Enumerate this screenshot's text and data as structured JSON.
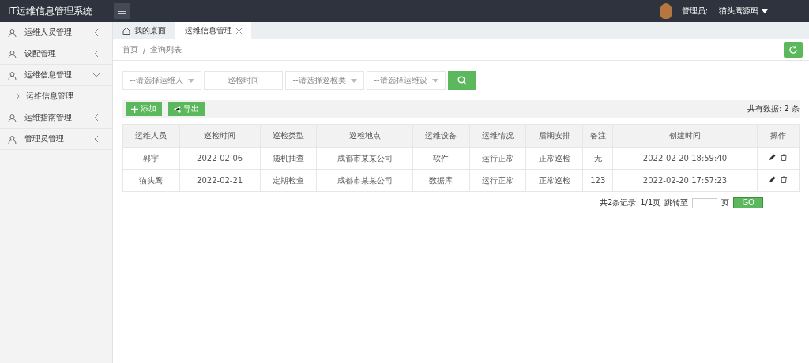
{
  "header": {
    "title": "IT运维信息管理系统",
    "user_label": "管理员:",
    "user_name": "猫头鹰源码"
  },
  "sidebar": {
    "items": [
      {
        "label": "运维人员管理",
        "expanded": false
      },
      {
        "label": "设配管理",
        "expanded": false
      },
      {
        "label": "运维信息管理",
        "expanded": true,
        "children": [
          {
            "label": "运维信息管理"
          }
        ]
      },
      {
        "label": "运维指南管理",
        "expanded": false
      },
      {
        "label": "管理员管理",
        "expanded": false
      }
    ]
  },
  "tabs": [
    {
      "label": "我的桌面",
      "selected": false,
      "closable": false
    },
    {
      "label": "运维信息管理",
      "selected": true,
      "closable": true
    }
  ],
  "breadcrumb": {
    "items": [
      "首页",
      "查询列表"
    ],
    "separator": "/"
  },
  "filters": [
    {
      "kind": "select",
      "placeholder": "--请选择运维人"
    },
    {
      "kind": "input",
      "placeholder": "巡检时间"
    },
    {
      "kind": "select",
      "placeholder": "--请选择巡检类"
    },
    {
      "kind": "select",
      "placeholder": "--请选择运维设"
    }
  ],
  "toolbar": {
    "buttons": [
      {
        "label": "添加",
        "kind": "add"
      },
      {
        "label": "导出",
        "kind": "export"
      }
    ],
    "total": "共有数据: 2 条"
  },
  "table": {
    "columns": [
      "运维人员",
      "巡检时间",
      "巡检类型",
      "巡检地点",
      "运维设备",
      "运维情况",
      "后期安排",
      "备注",
      "创建时间",
      "操作"
    ],
    "rows": [
      [
        "郭宇",
        "2022-02-06",
        "随机抽查",
        "成都市某某公司",
        "软件",
        "运行正常",
        "正常巡检",
        "无",
        "2022-02-20 18:59:40"
      ],
      [
        "猫头鹰",
        "2022-02-21",
        "定期检查",
        "成都市某某公司",
        "数据库",
        "运行正常",
        "正常巡检",
        "123",
        "2022-02-20 17:57:23"
      ]
    ]
  },
  "pagination": {
    "summary": "共2条记录",
    "pages": "1/1页",
    "jump_label": "跳转至",
    "page_suffix": "页",
    "go": "GO"
  }
}
